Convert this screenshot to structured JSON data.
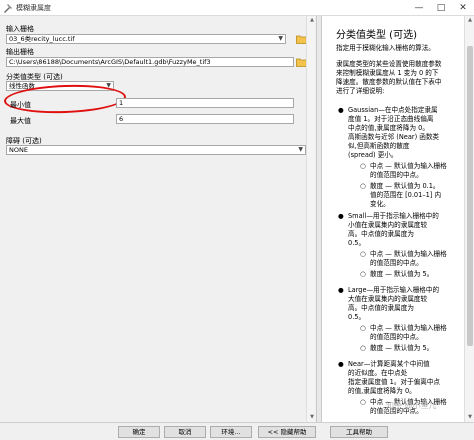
{
  "window": {
    "title": "模糊隶属度",
    "minimize": "—",
    "maximize": "□",
    "close": "✕"
  },
  "form": {
    "input_raster_label": "输入栅格",
    "input_raster_value": "03_6类recity_lucc.tif",
    "output_raster_label": "输出栅格",
    "output_raster_value": "C:\\Users\\86188\\Documents\\ArcGIS\\Default1.gdb\\FuzzyMe_tif3",
    "membership_type_label": "分类值类型 (可选)",
    "membership_type_value": "线性函数",
    "min_label": "最小值",
    "min_value": "1",
    "max_label": "最大值",
    "max_value": "6",
    "hedge_label": "障碍 (可选)",
    "hedge_value": "NONE"
  },
  "help": {
    "title": "分类值类型 (可选)",
    "intro": [
      "指定用于模糊化输入栅格的算法。"
    ],
    "para2": [
      "隶属度类型的某些设置使用散度参数",
      "来控制模糊隶属度从 1 变为 0 的下",
      "降速度。散度参数的默认值在下表中",
      "进行了详细说明:"
    ],
    "gaussian": [
      "Gaussian—在中点处指定隶属",
      "度值 1。对于沿正态曲线偏离",
      "中点的值,隶属度将降为 0。",
      "高斯函数与近邻 (Near) 函数类",
      "似,但高斯函数的散度",
      "(spread) 更小。"
    ],
    "gaussian_sub": [
      [
        "中点 — 默认值为输入栅格",
        "的值范围的中点。"
      ],
      [
        "散度 — 默认值为 0.1。",
        "值的范围在 [0.01–1] 内",
        "变化。"
      ]
    ],
    "small": [
      "Small—用于指示输入栅格中的",
      "小值在隶属集内的隶属度较",
      "高。中点值的隶属度为",
      "0.5。"
    ],
    "small_sub": [
      [
        "中点 — 默认值为输入栅格",
        "的值范围的中点。"
      ],
      [
        "散度 — 默认值为 5。"
      ]
    ],
    "large": [
      "Large—用于指示输入栅格中的",
      "大值在隶属集内的隶属度较",
      "高。中点值的隶属度为",
      "0.5。"
    ],
    "large_sub": [
      [
        "中点 — 默认值为输入栅格",
        "的值范围的中点。"
      ],
      [
        "散度 — 默认值为 5。"
      ]
    ],
    "near": [
      "Near—计算距离某个中间值",
      "的近似度。在中点处",
      "指定隶属度值 1。对于偏离中点",
      "的值,隶属度将降为 0。"
    ],
    "near_sub": [
      [
        "中点 — 默认值为输入栅格",
        "的值范围的中点。"
      ]
    ]
  },
  "buttons": {
    "ok": "确定",
    "cancel": "取消",
    "environments": "环境...",
    "hide_help": "<< 隐藏帮助",
    "tool_help": "工具帮助"
  },
  "watermark": "知乎 @小鱼儿"
}
